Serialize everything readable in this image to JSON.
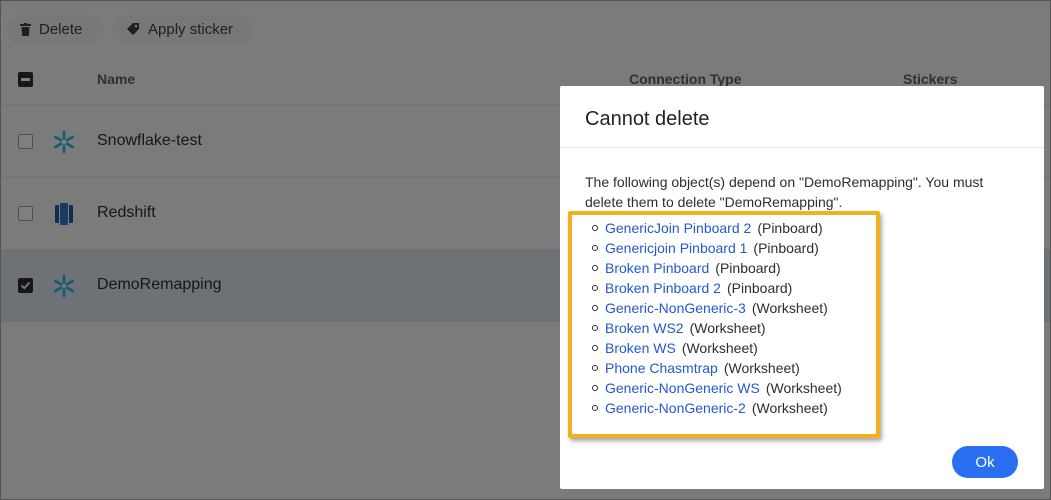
{
  "toolbar": {
    "delete_label": "Delete",
    "sticker_label": "Apply sticker"
  },
  "table": {
    "columns": [
      "Name",
      "Connection Type",
      "Stickers"
    ],
    "rows": [
      {
        "name": "Snowflake-test",
        "icon": "snowflake-icon",
        "checked": false
      },
      {
        "name": "Redshift",
        "icon": "redshift-icon",
        "checked": false
      },
      {
        "name": "DemoRemapping",
        "icon": "snowflake-icon",
        "checked": true
      }
    ]
  },
  "modal": {
    "title": "Cannot delete",
    "message": "The following object(s) depend on \"DemoRemapping\". You must delete them to delete \"DemoRemapping\".",
    "dependencies": [
      {
        "name": "GenericJoin Pinboard 2",
        "type": "(Pinboard)"
      },
      {
        "name": "Genericjoin Pinboard 1",
        "type": "(Pinboard)"
      },
      {
        "name": "Broken Pinboard",
        "type": "(Pinboard)"
      },
      {
        "name": "Broken Pinboard 2",
        "type": "(Pinboard)"
      },
      {
        "name": "Generic-NonGeneric-3",
        "type": "(Worksheet)"
      },
      {
        "name": "Broken WS2",
        "type": "(Worksheet)"
      },
      {
        "name": "Broken WS",
        "type": "(Worksheet)"
      },
      {
        "name": "Phone Chasmtrap",
        "type": "(Worksheet)"
      },
      {
        "name": "Generic-NonGeneric WS",
        "type": "(Worksheet)"
      },
      {
        "name": "Generic-NonGeneric-2",
        "type": "(Worksheet)"
      }
    ],
    "ok_label": "Ok"
  },
  "colors": {
    "accent": "#2a6ff2",
    "link": "#2359d1",
    "highlight": "#f2b01e",
    "snowflake": "#29b5e8",
    "redshift": "#205b98"
  }
}
